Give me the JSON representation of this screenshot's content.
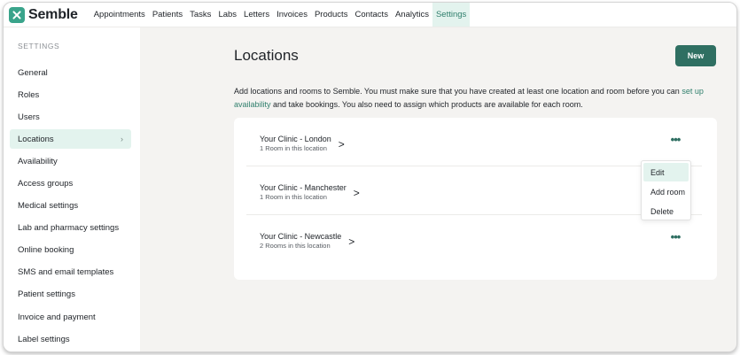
{
  "brand": {
    "name": "Semble"
  },
  "nav": [
    {
      "label": "Appointments"
    },
    {
      "label": "Patients"
    },
    {
      "label": "Tasks"
    },
    {
      "label": "Labs"
    },
    {
      "label": "Letters"
    },
    {
      "label": "Invoices"
    },
    {
      "label": "Products"
    },
    {
      "label": "Contacts"
    },
    {
      "label": "Analytics"
    },
    {
      "label": "Settings",
      "active": true
    }
  ],
  "sidebar": {
    "heading": "SETTINGS",
    "items": [
      {
        "label": "General"
      },
      {
        "label": "Roles"
      },
      {
        "label": "Users"
      },
      {
        "label": "Locations",
        "active": true,
        "chevron": "›"
      },
      {
        "label": "Availability"
      },
      {
        "label": "Access groups"
      },
      {
        "label": "Medical settings"
      },
      {
        "label": "Lab and pharmacy settings"
      },
      {
        "label": "Online booking"
      },
      {
        "label": "SMS and email templates"
      },
      {
        "label": "Patient settings"
      },
      {
        "label": "Invoice and payment"
      },
      {
        "label": "Label settings"
      }
    ]
  },
  "main": {
    "title": "Locations",
    "new_label": "New",
    "description": {
      "before": "Add locations and rooms to Semble. You must make sure that you have created at least one location and room before you can ",
      "link": "set up availability",
      "after": " and take bookings. You also need to assign which products are available for each room."
    },
    "locations": [
      {
        "name": "Your Clinic - London",
        "rooms": "1 Room in this location",
        "has_menu": true
      },
      {
        "name": "Your Clinic - Manchester",
        "rooms": "1 Room in this location",
        "has_menu": false
      },
      {
        "name": "Your Clinic - Newcastle",
        "rooms": "2 Rooms in this location",
        "has_menu": true
      }
    ],
    "chevron": ">",
    "more": "•••",
    "menu": [
      {
        "label": "Edit",
        "active": true
      },
      {
        "label": "Add room"
      },
      {
        "label": "Delete"
      }
    ]
  },
  "colors": {
    "accent": "#2f6f62",
    "accent_light": "#e3f3ee",
    "link": "#2f7f6c",
    "background": "#f4f3f1"
  }
}
